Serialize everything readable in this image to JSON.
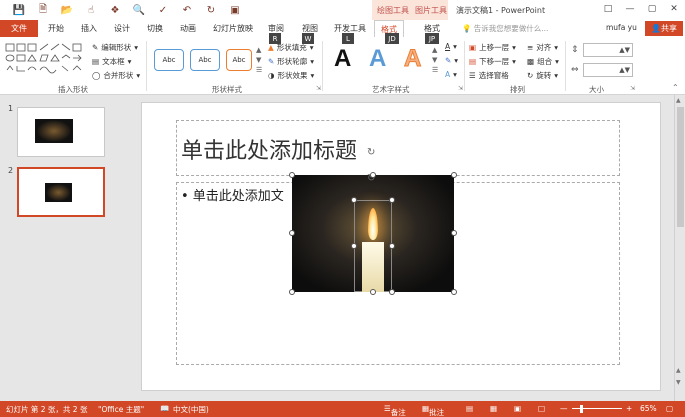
{
  "titlebar": {
    "drawing_tools": "绘图工具",
    "picture_tools": "图片工具",
    "window_title": "演示文稿1 - PowerPoint",
    "qat_icons": [
      "save-icon",
      "new-icon",
      "open-icon",
      "touch-icon",
      "format-painter-icon",
      "preview-icon",
      "spell-icon",
      "undo-icon",
      "redo-icon",
      "present-icon"
    ]
  },
  "tabs": {
    "file": "文件",
    "items": [
      "开始",
      "插入",
      "设计",
      "切换",
      "动画",
      "幻灯片放映",
      "审阅",
      "视图",
      "开发工具",
      "格式",
      "格式"
    ],
    "tell_me": "告诉我您想要做什么...",
    "user": "mufa yu",
    "share": "共享"
  },
  "ribbon": {
    "insert_shapes": {
      "label": "插入形状",
      "edit_shape": "编辑形状",
      "text_box": "文本框",
      "merge_shapes": "合并形状"
    },
    "shape_styles": {
      "label": "形状样式",
      "style1": "Abc",
      "style2": "Abc",
      "style3": "Abc",
      "fill": "形状填充",
      "outline": "形状轮廓",
      "effects": "形状效果"
    },
    "wordart": {
      "label": "艺术字样式",
      "a1": "A",
      "a2": "A",
      "a3": "A"
    },
    "arrange": {
      "label": "排列",
      "bring_forward": "上移一层",
      "send_backward": "下移一层",
      "selection_pane": "选择窗格",
      "align": "对齐",
      "group": "组合",
      "rotate": "旋转"
    },
    "size": {
      "label": "大小"
    },
    "keytips": [
      "R",
      "W",
      "L",
      "JD",
      "JP"
    ]
  },
  "thumbs": {
    "n1": "1",
    "n2": "2"
  },
  "slide": {
    "title": "单击此处添加标题",
    "body": "• 单击此处添加文"
  },
  "status": {
    "slide_info": "幻灯片 第 2 张，共 2 张",
    "theme": "\"Office 主题\"",
    "language": "中文(中国)",
    "notes": "备注",
    "comments": "批注",
    "zoom": "65%"
  },
  "colors": {
    "accent": "#d24726",
    "context_tab": "#fbe4d9"
  }
}
